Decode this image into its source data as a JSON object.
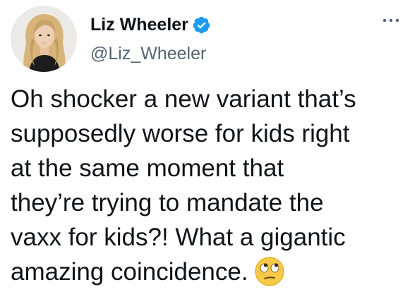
{
  "author": {
    "display_name": "Liz Wheeler",
    "handle": "@Liz_Wheeler",
    "verified": true
  },
  "tweet": {
    "lines": [
      "Oh shocker a new variant that’s",
      "supposedly worse for kids right",
      "at the same moment that",
      "they’re trying to mandate the",
      "vaxx for kids?! What a gigantic",
      "amazing coincidence."
    ],
    "trailing_emoji": "face-with-rolling-eyes"
  },
  "colors": {
    "text_primary": "#0f1419",
    "text_secondary": "#536471",
    "verified_blue": "#1d9bf0",
    "emoji_yellow": "#f7c948"
  },
  "icons": {
    "more": "more-options-icon",
    "verified": "verified-badge-icon",
    "emoji": "face-with-rolling-eyes"
  }
}
